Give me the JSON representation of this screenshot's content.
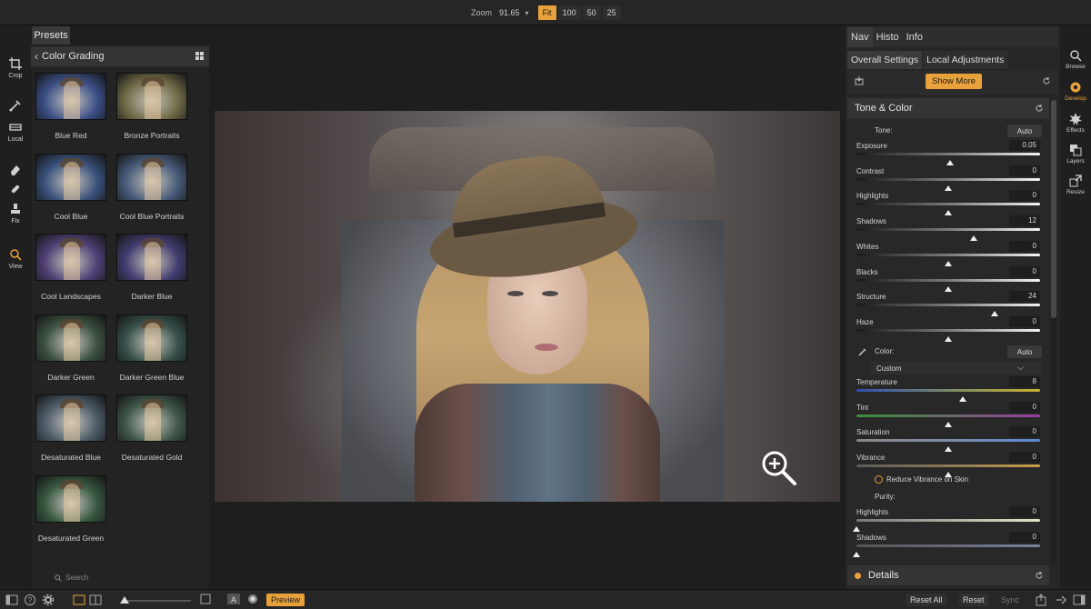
{
  "topbar": {
    "zoom_label": "Zoom",
    "zoom_value": "91.65",
    "zoom_buttons": [
      {
        "label": "Fit",
        "active": true
      },
      {
        "label": "100",
        "active": false
      },
      {
        "label": "50",
        "active": false
      },
      {
        "label": "25",
        "active": false
      }
    ]
  },
  "tools": {
    "crop": "Crop",
    "local": "Local",
    "fix": "Fix",
    "view": "View"
  },
  "presets": {
    "tab_label": "Presets",
    "category": "Color Grading",
    "items": [
      {
        "label": "Blue Red",
        "tint": "#3b4f86"
      },
      {
        "label": "Bronze Portraits",
        "tint": "#6f6a46"
      },
      {
        "label": "Cool Blue",
        "tint": "#38507a"
      },
      {
        "label": "Cool Blue Portraits",
        "tint": "#465a78"
      },
      {
        "label": "Cool Landscapes",
        "tint": "#4e3f74"
      },
      {
        "label": "Darker Blue",
        "tint": "#413c6e"
      },
      {
        "label": "Darker Green",
        "tint": "#3b5040"
      },
      {
        "label": "Darker Green Blue",
        "tint": "#36514a"
      },
      {
        "label": "Desaturated Blue",
        "tint": "#4b5a66"
      },
      {
        "label": "Desaturated Gold",
        "tint": "#3e5648"
      },
      {
        "label": "Desaturated Green",
        "tint": "#36563f"
      }
    ],
    "search_placeholder": "Search"
  },
  "right_panel": {
    "nav_tabs": [
      "Nav",
      "Histo",
      "Info"
    ],
    "settings_tabs": [
      "Overall Settings",
      "Local Adjustments"
    ],
    "show_more": "Show More",
    "tone_color": {
      "title": "Tone & Color",
      "tone_label": "Tone:",
      "tone_auto": "Auto",
      "sliders": [
        {
          "label": "Exposure",
          "value": "0.05",
          "pos": 0.51
        },
        {
          "label": "Contrast",
          "value": "0",
          "pos": 0.5
        },
        {
          "label": "Highlights",
          "value": "0",
          "pos": 0.5
        },
        {
          "label": "Shadows",
          "value": "12",
          "pos": 0.64
        },
        {
          "label": "Whites",
          "value": "0",
          "pos": 0.5
        },
        {
          "label": "Blacks",
          "value": "0",
          "pos": 0.5
        },
        {
          "label": "Structure",
          "value": "24",
          "pos": 0.75
        },
        {
          "label": "Haze",
          "value": "0",
          "pos": 0.5
        }
      ],
      "color_label": "Color:",
      "color_auto": "Auto",
      "color_mode": "Custom",
      "color_sliders": [
        {
          "label": "Temperature",
          "value": "8",
          "pos": 0.58
        },
        {
          "label": "Tint",
          "value": "0",
          "pos": 0.5
        },
        {
          "label": "Saturation",
          "value": "0",
          "pos": 0.5
        },
        {
          "label": "Vibrance",
          "value": "0",
          "pos": 0.5
        }
      ],
      "reduce_vibrance": "Reduce Vibrance on Skin",
      "purity_label": "Purity:",
      "purity_sliders": [
        {
          "label": "Highlights",
          "value": "0",
          "pos": 0.0
        },
        {
          "label": "Shadows",
          "value": "0",
          "pos": 0.0
        }
      ]
    },
    "details_title": "Details"
  },
  "modules": {
    "browse": "Browse",
    "develop": "Develop",
    "effects": "Effects",
    "layers": "Layers",
    "resize": "Resize"
  },
  "bottombar": {
    "preview": "Preview",
    "reset_all": "Reset All",
    "reset": "Reset",
    "sync": "Sync"
  },
  "colors": {
    "accent": "#e9a23b",
    "panel": "#262626",
    "background": "#1e1e1e"
  }
}
